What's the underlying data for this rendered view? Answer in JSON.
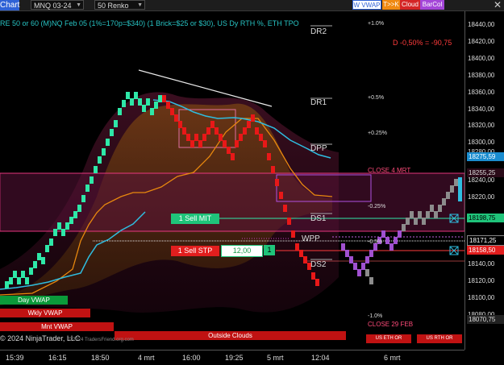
{
  "toolbar": {
    "chart_label": "Chart",
    "instrument": "MNQ 03-24",
    "bar_type": "50 Renko",
    "buttons": [
      "W VWAP",
      "T>>K",
      "Cloud",
      "BarCol"
    ]
  },
  "info_text": "RE 50 or 60 (M)NQ Feb 05 (1%=170p=$340) (1 Brick=$25 or $30), US Dy RTH %, ETH TPO",
  "daily_change": "D -0,50% = -90,75",
  "percent_labels": [
    "+1.0%",
    "+0.5%",
    "+0.25%",
    "-0.25%",
    "-0.5%",
    "-1.0%"
  ],
  "levels": [
    "DR2",
    "DR1",
    "DPP",
    "DS1",
    "WPP",
    "DS2"
  ],
  "close_labels": [
    "CLOSE 4 MRT",
    "CLOSE 29 FEB"
  ],
  "orders": {
    "sell_mit": "1 Sell MIT",
    "sell_stp": "1 Sell STP",
    "quantity": "12,00",
    "qty_count": "1"
  },
  "vwap_tags": [
    "Day VWAP",
    "Wkly VWAP",
    "Mnt VWAP",
    "Outside Clouds"
  ],
  "session_tags": [
    "US ETH OR",
    "US RTH OR"
  ],
  "copyright": "© 2024 NinjaTrader, LLC",
  "watermark": "© 2024 TradersFriend.org.com",
  "price_axis": [
    "18440,00",
    "18420,00",
    "18400,00",
    "18380,00",
    "18360,00",
    "18340,00",
    "18320,00",
    "18300,00",
    "18280,00",
    "18260,00",
    "18240,00",
    "18220,00",
    "18200,00",
    "18180,00",
    "18160,00",
    "18140,00",
    "18120,00",
    "18100,00",
    "18080,00"
  ],
  "price_badges": [
    "18275,59",
    "18255,25",
    "18198,75",
    "18171,25",
    "18158,50",
    "18070,75"
  ],
  "time_axis": [
    "15:39",
    "16:15",
    "18:50",
    "4 mrt",
    "16:00",
    "19:25",
    "5 mrt",
    "12:04",
    "6 mrt"
  ],
  "colors": {
    "up_brick": "#2ee8a8",
    "down_brick": "#e81818",
    "vwap": "#2fbde0",
    "orange": "#e8880e",
    "cloud": "#ff3c8c",
    "up_after": "#a050d0",
    "gray": "#8c8c8c"
  }
}
